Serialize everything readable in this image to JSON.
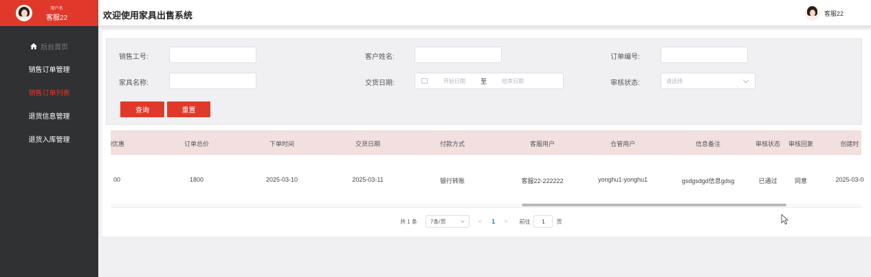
{
  "sidebar": {
    "user_label": "用户名",
    "user_name": "客服22",
    "items": [
      {
        "label": "后台首页"
      },
      {
        "label": "销售订单管理"
      },
      {
        "label": "销售订单列表"
      },
      {
        "label": "退货信息管理"
      },
      {
        "label": "退货入库管理"
      }
    ]
  },
  "header": {
    "title": "欢迎使用家具出售系统",
    "user_name": "客服22"
  },
  "filter": {
    "sales_id_label": "销售工号:",
    "customer_name_label": "客户姓名:",
    "order_no_label": "订单编号:",
    "furniture_name_label": "家具名称:",
    "delivery_date_label": "交货日期:",
    "review_status_label": "审核状态:",
    "date_start_placeholder": "开始日期",
    "date_separator": "至",
    "date_end_placeholder": "结束日期",
    "review_status_placeholder": "请选择",
    "query_button": "查询",
    "reset_button": "重置"
  },
  "table": {
    "columns": [
      "l优惠",
      "订单总价",
      "下单时间",
      "交货日期",
      "付款方式",
      "客服用户",
      "仓管用户",
      "信息备注",
      "审核状态",
      "审核回复",
      "创建时"
    ],
    "rows": [
      [
        "00",
        "1800",
        "2025-03-10",
        "2025-03-11",
        "银行转账",
        "客服22-222222",
        "yonghu1-yonghu1",
        "gsdgsdgd信息gdsg",
        "已通过",
        "同意",
        "2025-03-0"
      ]
    ]
  },
  "pagination": {
    "total": "共 1 条",
    "page_size": "7条/页",
    "prev": "<",
    "current": "1",
    "next": ">",
    "goto_label": "前往",
    "goto_value": "1",
    "page_suffix": "页"
  },
  "colors": {
    "accent": "#e0392b",
    "sidebar_bg": "#2f3133",
    "table_header_bg": "#f2dfe0",
    "link_blue": "#1e6fd9"
  }
}
